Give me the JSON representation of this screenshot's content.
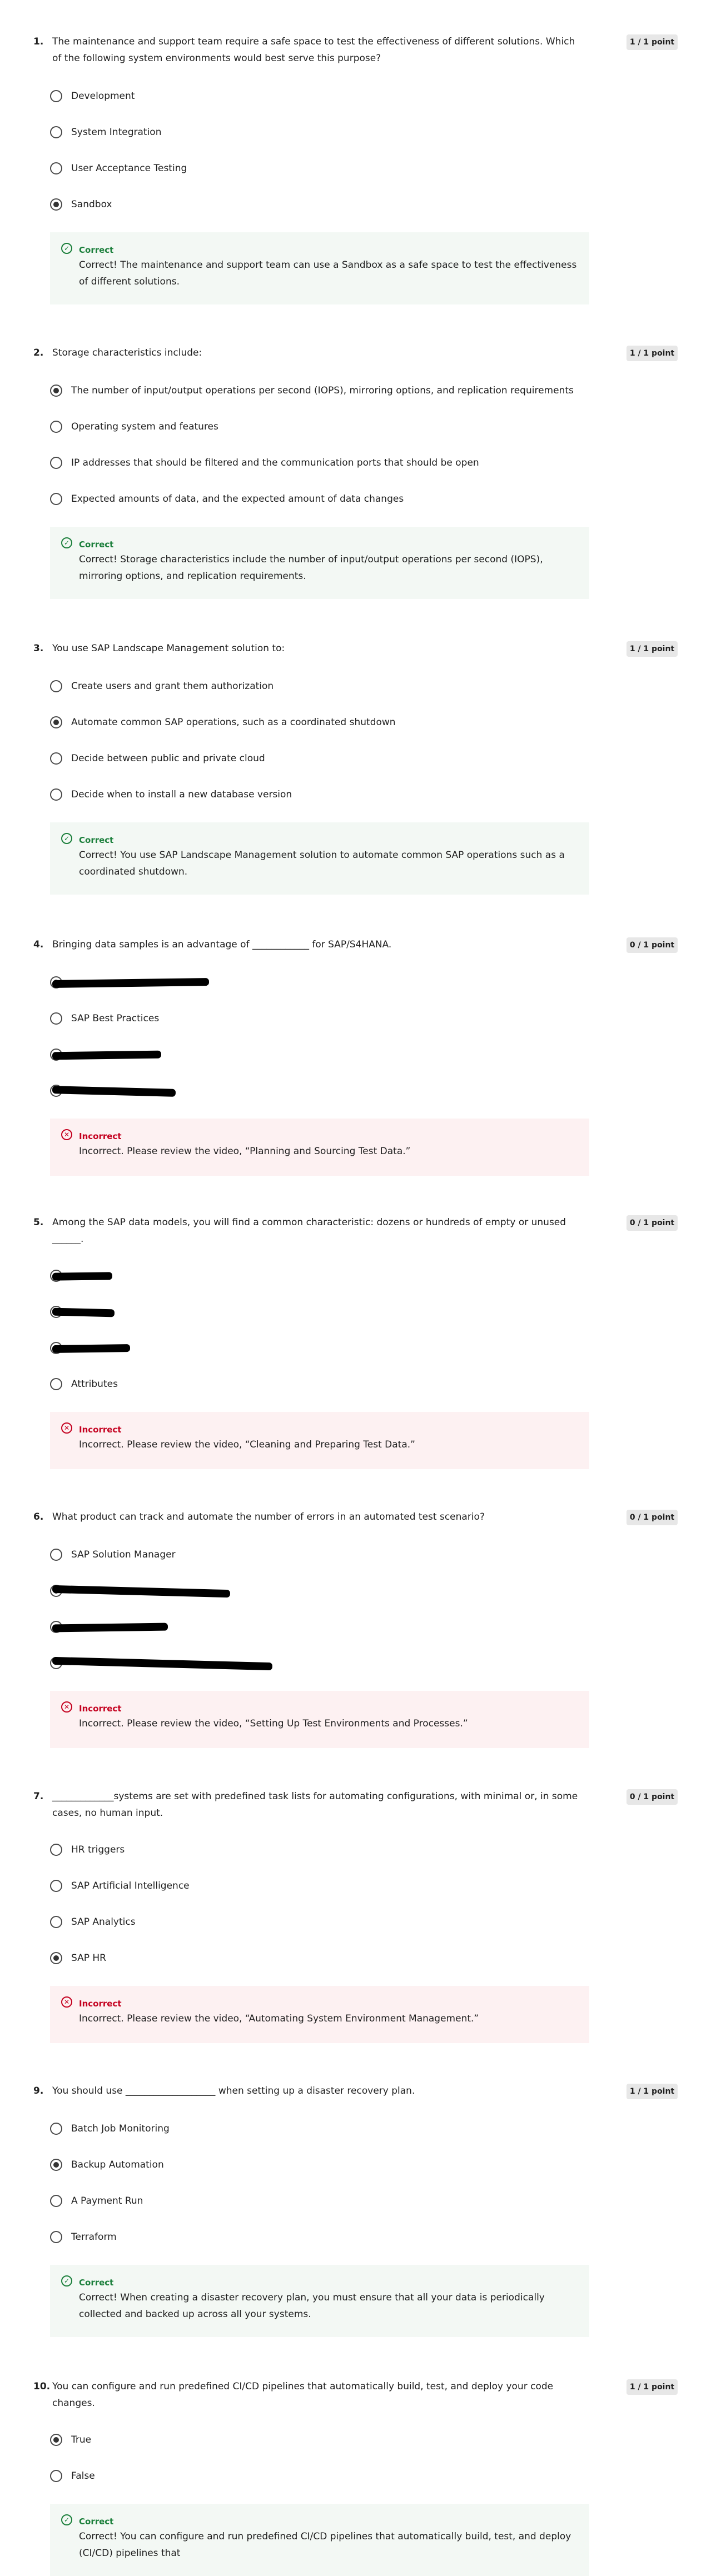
{
  "points_label_correct": "1 / 1 point",
  "points_label_incorrect": "0 / 1 point",
  "feedback_titles": {
    "correct": "Correct",
    "incorrect": "Incorrect"
  },
  "questions": [
    {
      "number": "1.",
      "text": "The maintenance and support team require a safe space to test the effectiveness of different solutions. Which of the following system environments would best serve this purpose?",
      "points": "1 / 1 point",
      "options": [
        {
          "label": "Development",
          "selected": false
        },
        {
          "label": "System Integration",
          "selected": false
        },
        {
          "label": "User Acceptance Testing",
          "selected": false
        },
        {
          "label": "Sandbox",
          "selected": true
        }
      ],
      "feedback": {
        "status": "correct",
        "title": "Correct",
        "text": "Correct! The maintenance and support team can use a Sandbox as a safe space to test the effectiveness of different solutions."
      }
    },
    {
      "number": "2.",
      "text": "Storage characteristics include:",
      "points": "1 / 1 point",
      "options": [
        {
          "label": "The number of input/output operations per second (IOPS), mirroring options, and replication requirements",
          "selected": true
        },
        {
          "label": "Operating system and features",
          "selected": false
        },
        {
          "label": "IP addresses that should be filtered and the communication ports that should be open",
          "selected": false
        },
        {
          "label": "Expected amounts of data, and the expected amount of data changes",
          "selected": false
        }
      ],
      "feedback": {
        "status": "correct",
        "title": "Correct",
        "text": "Correct! Storage characteristics include the number of input/output operations per second (IOPS), mirroring options, and replication requirements."
      }
    },
    {
      "number": "3.",
      "text": "You use SAP Landscape Management solution to:",
      "points": "1 / 1 point",
      "options": [
        {
          "label": "Create users and grant them authorization",
          "selected": false
        },
        {
          "label": "Automate common SAP operations, such as a coordinated shutdown",
          "selected": true
        },
        {
          "label": "Decide between public and private cloud",
          "selected": false
        },
        {
          "label": "Decide when to install a new database version",
          "selected": false
        }
      ],
      "feedback": {
        "status": "correct",
        "title": "Correct",
        "text": "Correct! You use SAP Landscape Management solution to automate common SAP operations such as a coordinated shutdown."
      }
    },
    {
      "number": "4.",
      "text": "Bringing data samples is an advantage of ____________ for SAP/S4HANA.",
      "points": "0 / 1 point",
      "options": [
        {
          "label": "",
          "selected": true,
          "redacted": true
        },
        {
          "label": "SAP Best Practices",
          "selected": false
        },
        {
          "label": "",
          "selected": false,
          "redacted": true
        },
        {
          "label": "",
          "selected": false,
          "redacted": true
        }
      ],
      "feedback": {
        "status": "incorrect",
        "title": "Incorrect",
        "text": "Incorrect. Please review the video, “Planning and Sourcing Test Data.”"
      }
    },
    {
      "number": "5.",
      "text": "Among the SAP data models, you will find a common characteristic: dozens or hundreds of empty or unused ______.",
      "points": "0 / 1 point",
      "options": [
        {
          "label": "",
          "selected": true,
          "redacted": true
        },
        {
          "label": "",
          "selected": false,
          "redacted": true
        },
        {
          "label": "",
          "selected": false,
          "redacted": true
        },
        {
          "label": "Attributes",
          "selected": false
        }
      ],
      "feedback": {
        "status": "incorrect",
        "title": "Incorrect",
        "text": "Incorrect. Please review the video, “Cleaning and Preparing Test Data.”"
      }
    },
    {
      "number": "6.",
      "text": "What product can track and automate the number of errors in an automated test scenario?",
      "points": "0 / 1 point",
      "options": [
        {
          "label": "SAP Solution Manager",
          "selected": false
        },
        {
          "label": "",
          "selected": true,
          "redacted": true
        },
        {
          "label": "",
          "selected": false,
          "redacted": true
        },
        {
          "label": "",
          "selected": false,
          "redacted": true
        }
      ],
      "feedback": {
        "status": "incorrect",
        "title": "Incorrect",
        "text": "Incorrect. Please review the video, “Setting Up Test Environments and Processes.”"
      }
    },
    {
      "number": "7.",
      "text": "_____________systems are set with predefined task lists for automating configurations, with minimal or, in some cases, no human input.",
      "points": "0 / 1 point",
      "options": [
        {
          "label": "HR triggers",
          "selected": false
        },
        {
          "label": "SAP Artificial Intelligence",
          "selected": false
        },
        {
          "label": "SAP Analytics",
          "selected": false
        },
        {
          "label": "SAP HR",
          "selected": true
        }
      ],
      "feedback": {
        "status": "incorrect",
        "title": "Incorrect",
        "text": "Incorrect. Please review the video, “Automating System Environment Management.”"
      }
    },
    {
      "number": "9.",
      "text": "You should use ___________________ when setting up a disaster recovery plan.",
      "points": "1 / 1 point",
      "options": [
        {
          "label": "Batch Job Monitoring",
          "selected": false
        },
        {
          "label": "Backup Automation",
          "selected": true
        },
        {
          "label": "A Payment Run",
          "selected": false
        },
        {
          "label": "Terraform",
          "selected": false
        }
      ],
      "feedback": {
        "status": "correct",
        "title": "Correct",
        "text": "Correct! When creating a disaster recovery plan, you must ensure that all your data is periodically collected and backed up across all your systems."
      }
    },
    {
      "number": "10.",
      "text": "You can configure and run predefined CI/CD pipelines that automatically build, test, and deploy your code changes.",
      "points": "1 / 1 point",
      "options": [
        {
          "label": "True",
          "selected": true
        },
        {
          "label": "False",
          "selected": false
        }
      ],
      "feedback": {
        "status": "correct",
        "title": "Correct",
        "text": "Correct! You can configure and run predefined CI/CD pipelines that automatically build, test, and deploy (CI/CD) pipelines that"
      }
    }
  ]
}
